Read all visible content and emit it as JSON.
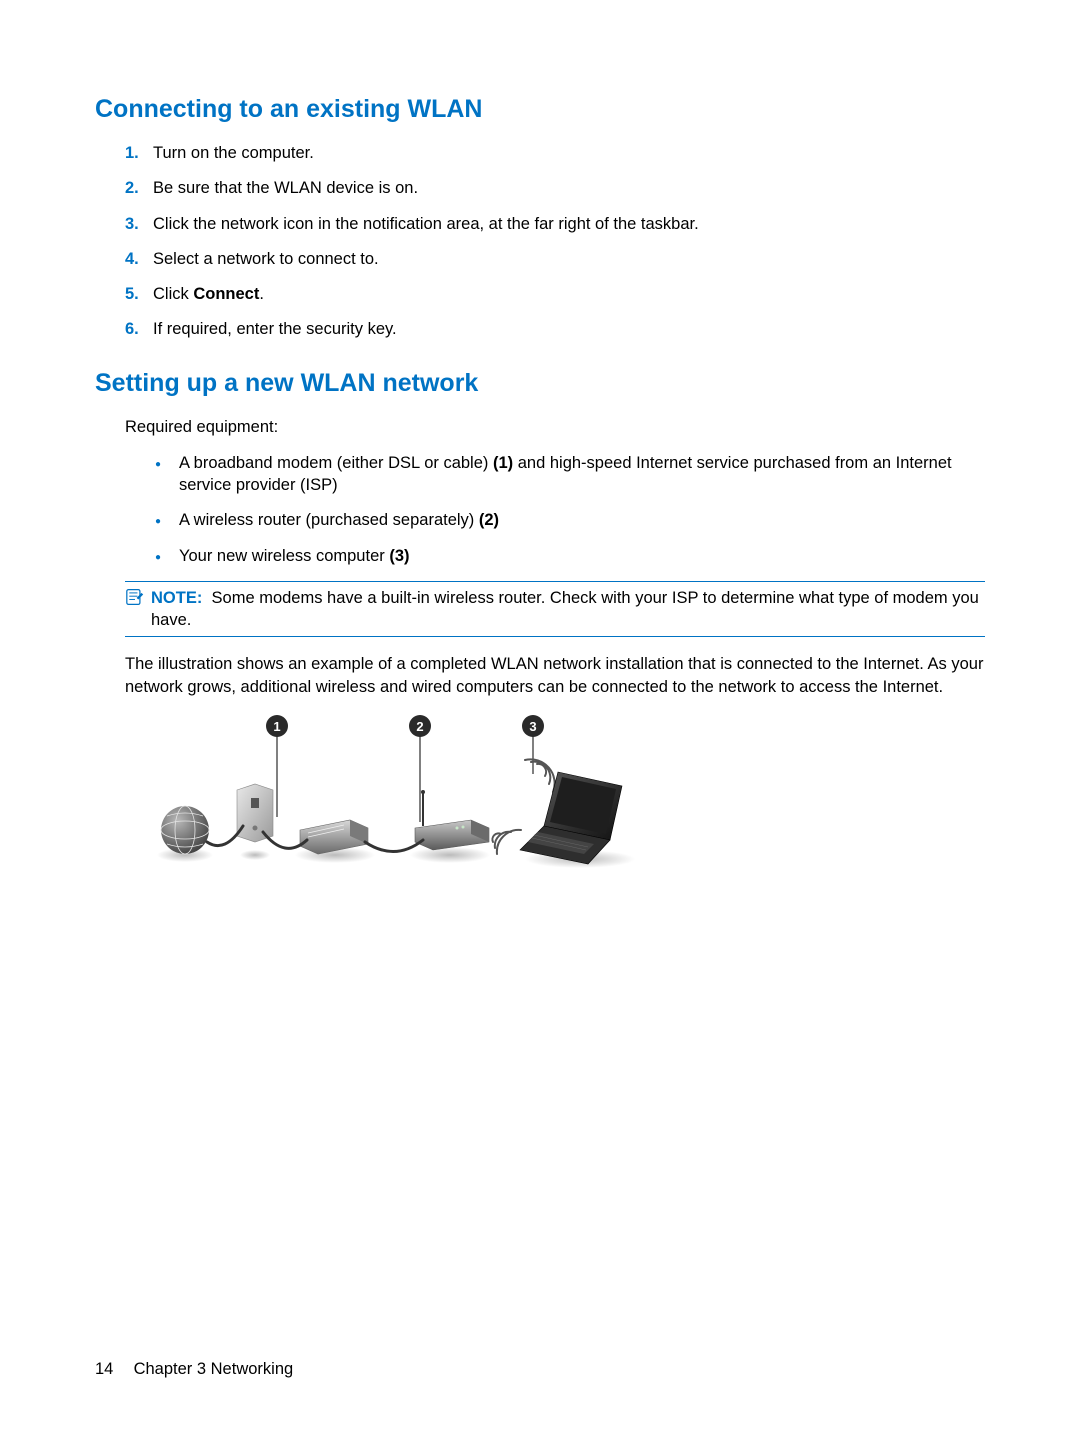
{
  "section1": {
    "title": "Connecting to an existing WLAN",
    "steps": [
      {
        "num": "1.",
        "text": "Turn on the computer."
      },
      {
        "num": "2.",
        "text": "Be sure that the WLAN device is on."
      },
      {
        "num": "3.",
        "text": "Click the network icon in the notification area, at the far right of the taskbar."
      },
      {
        "num": "4.",
        "text": "Select a network to connect to."
      },
      {
        "num": "5.",
        "prefix": "Click ",
        "bold": "Connect",
        "suffix": "."
      },
      {
        "num": "6.",
        "text": "If required, enter the security key."
      }
    ]
  },
  "section2": {
    "title": "Setting up a new WLAN network",
    "intro": "Required equipment:",
    "bullets": [
      {
        "pre": "A broadband modem (either DSL or cable) ",
        "b": "(1)",
        "post": " and high-speed Internet service purchased from an Internet service provider (ISP)"
      },
      {
        "pre": "A wireless router (purchased separately) ",
        "b": "(2)",
        "post": ""
      },
      {
        "pre": "Your new wireless computer ",
        "b": "(3)",
        "post": ""
      }
    ],
    "note": {
      "label": "NOTE:",
      "text": "Some modems have a built-in wireless router. Check with your ISP to determine what type of modem you have."
    },
    "para": "The illustration shows an example of a completed WLAN network installation that is connected to the Internet. As your network grows, additional wireless and wired computers can be connected to the network to access the Internet.",
    "callouts": {
      "c1": "1",
      "c2": "2",
      "c3": "3"
    }
  },
  "footer": {
    "page": "14",
    "chapter": "Chapter 3   Networking"
  }
}
